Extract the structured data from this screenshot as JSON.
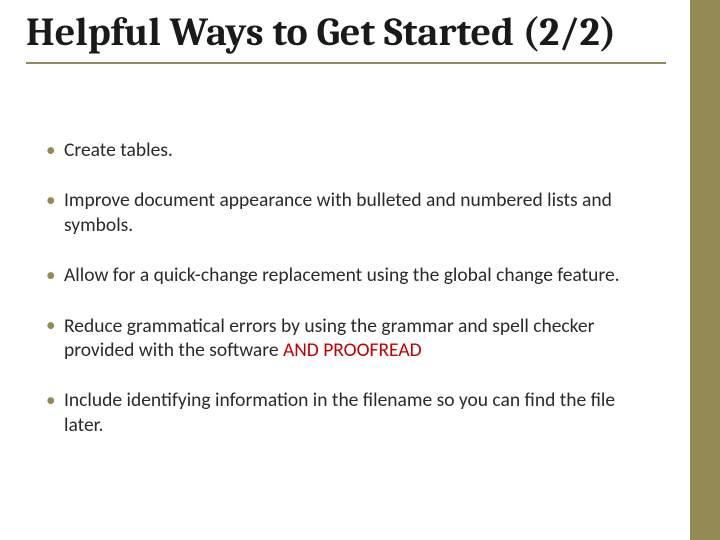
{
  "title": "Helpful Ways to Get Started (2/2)",
  "bullets": [
    {
      "text": "Create tables."
    },
    {
      "text": "Improve document appearance with bulleted and numbered lists and symbols."
    },
    {
      "text": "Allow for a quick-change replacement using the global change feature."
    },
    {
      "text": "Reduce grammatical errors by using the grammar and spell checker provided with the software ",
      "emphasis": "AND PROOFREAD"
    },
    {
      "text": "Include identifying information in the filename so you can find the file later."
    }
  ],
  "accent_color": "#948a54",
  "emphasis_color": "#c00000"
}
